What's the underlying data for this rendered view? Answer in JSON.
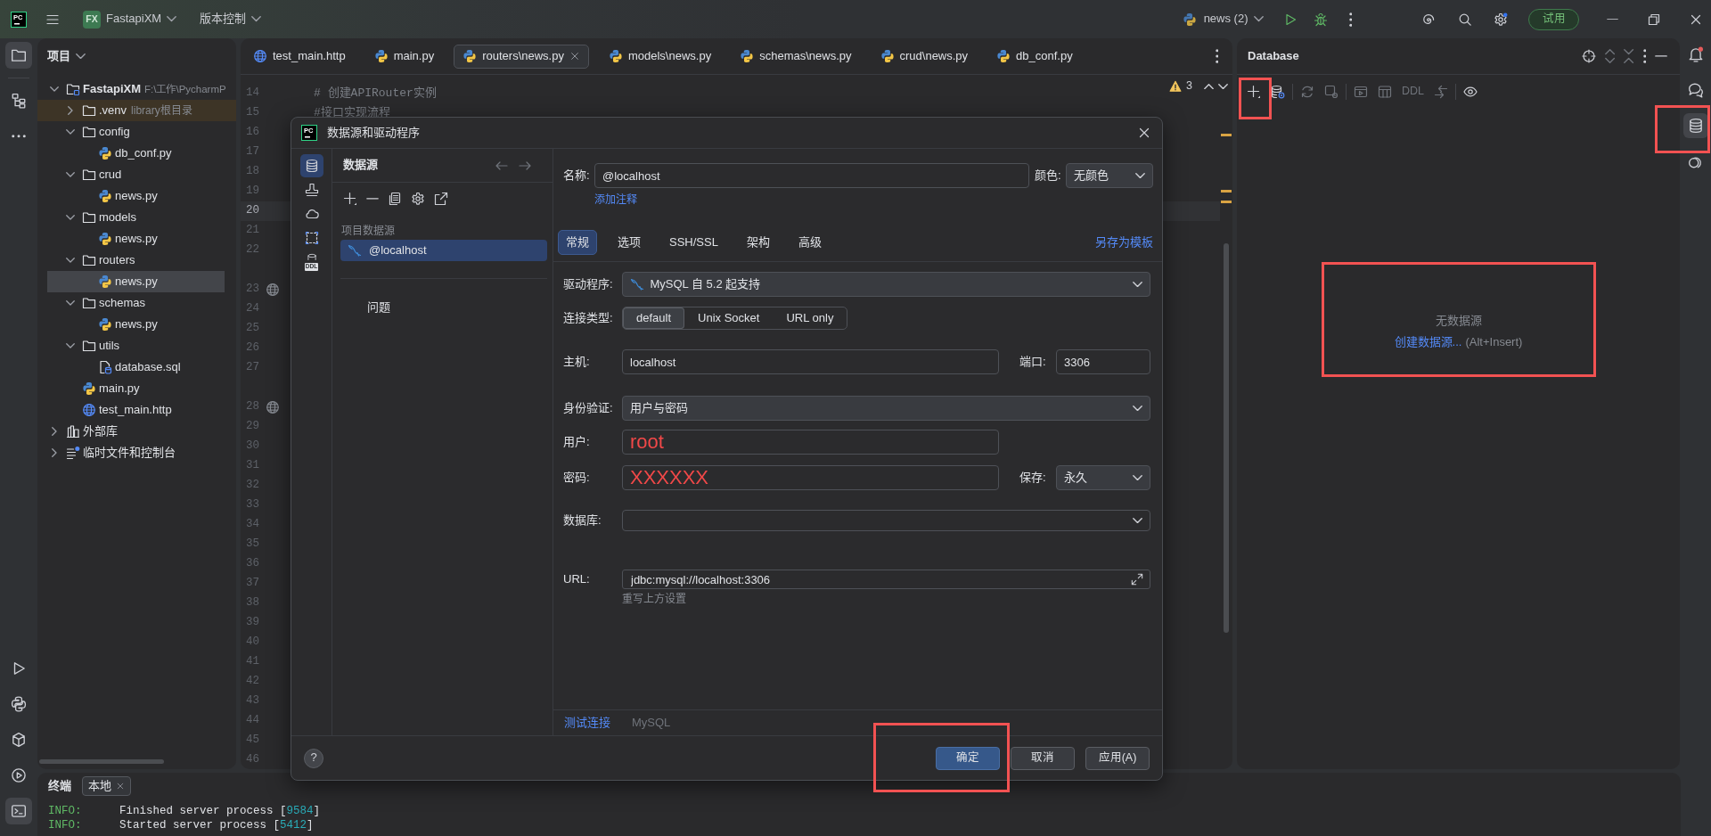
{
  "title_bar": {
    "logo": "PC",
    "project_badge": "FX",
    "project": "FastapiXM",
    "vcs": "版本控制",
    "run_config": "news (2)",
    "trial": "试用"
  },
  "left_strip": {
    "top": [
      {
        "selected": true
      },
      {
        "selected": false
      },
      {
        "selected": false
      }
    ],
    "bottom": [
      {
        "selected": false
      },
      {
        "selected": false
      },
      {
        "selected": false
      },
      {
        "selected": false
      },
      {
        "selected": true
      }
    ]
  },
  "project_panel": {
    "title": "项目",
    "tree": [
      {
        "kind": "project",
        "label": "FastapiXM",
        "note": "F:\\工作\\PycharmP",
        "expanded": true,
        "selected": false,
        "excluded": false,
        "children": [
          {
            "kind": "folder",
            "label": ".venv",
            "note": "library根目录",
            "expanded": false,
            "selected": false,
            "excluded": true
          },
          {
            "kind": "folder",
            "label": "config",
            "expanded": true,
            "selected": false,
            "excluded": false,
            "children": [
              {
                "kind": "python",
                "label": "db_conf.py",
                "selected": false,
                "excluded": false
              }
            ]
          },
          {
            "kind": "folder",
            "label": "crud",
            "expanded": true,
            "selected": false,
            "excluded": false,
            "children": [
              {
                "kind": "python",
                "label": "news.py",
                "selected": false,
                "excluded": false
              }
            ]
          },
          {
            "kind": "folder",
            "label": "models",
            "expanded": true,
            "selected": false,
            "excluded": false,
            "children": [
              {
                "kind": "python",
                "label": "news.py",
                "selected": false,
                "excluded": false
              }
            ]
          },
          {
            "kind": "folder",
            "label": "routers",
            "expanded": true,
            "selected": false,
            "excluded": false,
            "children": [
              {
                "kind": "python",
                "label": "news.py",
                "selected": true,
                "excluded": false
              }
            ]
          },
          {
            "kind": "folder",
            "label": "schemas",
            "expanded": true,
            "selected": false,
            "excluded": false,
            "children": [
              {
                "kind": "python",
                "label": "news.py",
                "selected": false,
                "excluded": false
              }
            ]
          },
          {
            "kind": "folder",
            "label": "utils",
            "expanded": true,
            "selected": false,
            "excluded": false,
            "children": [
              {
                "kind": "sql",
                "label": "database.sql",
                "selected": false,
                "excluded": false
              }
            ]
          },
          {
            "kind": "python",
            "label": "main.py",
            "selected": false,
            "excluded": false
          },
          {
            "kind": "http",
            "label": "test_main.http",
            "selected": false,
            "excluded": false
          }
        ]
      },
      {
        "kind": "library",
        "label": "外部库",
        "expanded": false,
        "selected": false,
        "excluded": false
      },
      {
        "kind": "scratches",
        "label": "临时文件和控制台",
        "expanded": false,
        "selected": false,
        "excluded": false
      }
    ]
  },
  "editor": {
    "tabs": [
      {
        "label": "test_main.http",
        "kind": "http",
        "selected": false
      },
      {
        "label": "main.py",
        "kind": "python",
        "selected": false
      },
      {
        "label": "routers\\news.py",
        "kind": "python",
        "selected": true
      },
      {
        "label": "models\\news.py",
        "kind": "python",
        "selected": false
      },
      {
        "label": "schemas\\news.py",
        "kind": "python",
        "selected": false
      },
      {
        "label": "crud\\news.py",
        "kind": "python",
        "selected": false
      },
      {
        "label": "db_conf.py",
        "kind": "python",
        "selected": false
      }
    ],
    "problems": "3",
    "stripe_marks": [
      {
        "kind": "warning"
      },
      {
        "kind": "warning"
      },
      {
        "kind": "warning"
      }
    ],
    "lines": [
      {
        "kind": "line",
        "number": "14",
        "code": "# 创建APIRouter实例",
        "current": false,
        "endpoint": false
      },
      {
        "kind": "line",
        "number": "15",
        "code": "#接口实现流程",
        "current": false,
        "endpoint": false
      },
      {
        "kind": "line",
        "number": "16",
        "current": false,
        "endpoint": false
      },
      {
        "kind": "line",
        "number": "17",
        "current": false,
        "endpoint": false
      },
      {
        "kind": "line",
        "number": "18",
        "current": false,
        "endpoint": false
      },
      {
        "kind": "line",
        "number": "19",
        "current": false,
        "endpoint": false
      },
      {
        "kind": "line",
        "number": "20",
        "current": true,
        "endpoint": false
      },
      {
        "kind": "line",
        "number": "21",
        "current": false,
        "endpoint": false
      },
      {
        "kind": "line",
        "number": "22",
        "current": false,
        "endpoint": false
      },
      {
        "kind": "gap"
      },
      {
        "kind": "line",
        "number": "23",
        "current": false,
        "endpoint": true
      },
      {
        "kind": "line",
        "number": "24",
        "current": false,
        "endpoint": false
      },
      {
        "kind": "line",
        "number": "25",
        "current": false,
        "endpoint": false
      },
      {
        "kind": "line",
        "number": "26",
        "current": false,
        "endpoint": false
      },
      {
        "kind": "line",
        "number": "27",
        "current": false,
        "endpoint": false
      },
      {
        "kind": "gap"
      },
      {
        "kind": "line",
        "number": "28",
        "current": false,
        "endpoint": true
      },
      {
        "kind": "line",
        "number": "29",
        "current": false,
        "endpoint": false
      },
      {
        "kind": "line",
        "number": "30",
        "current": false,
        "endpoint": false
      },
      {
        "kind": "line",
        "number": "31",
        "current": false,
        "endpoint": false
      },
      {
        "kind": "line",
        "number": "32",
        "current": false,
        "endpoint": false
      },
      {
        "kind": "line",
        "number": "33",
        "current": false,
        "endpoint": false
      },
      {
        "kind": "line",
        "number": "34",
        "current": false,
        "endpoint": false
      },
      {
        "kind": "line",
        "number": "35",
        "current": false,
        "endpoint": false
      },
      {
        "kind": "line",
        "number": "36",
        "current": false,
        "endpoint": false
      },
      {
        "kind": "line",
        "number": "37",
        "current": false,
        "endpoint": false
      },
      {
        "kind": "line",
        "number": "38",
        "current": false,
        "endpoint": false
      },
      {
        "kind": "line",
        "number": "39",
        "current": false,
        "endpoint": false
      },
      {
        "kind": "line",
        "number": "40",
        "current": false,
        "endpoint": false
      },
      {
        "kind": "line",
        "number": "41",
        "current": false,
        "endpoint": false
      },
      {
        "kind": "line",
        "number": "42",
        "current": false,
        "endpoint": false
      },
      {
        "kind": "line",
        "number": "43",
        "current": false,
        "endpoint": false
      },
      {
        "kind": "line",
        "number": "44",
        "current": false,
        "endpoint": false
      },
      {
        "kind": "line",
        "number": "45",
        "current": false,
        "endpoint": false
      },
      {
        "kind": "line",
        "number": "46",
        "current": false,
        "endpoint": false
      }
    ]
  },
  "dialog": {
    "logo": "PC",
    "title": "数据源和驱动程序",
    "nav": [
      {
        "selected": true
      },
      {
        "selected": false
      },
      {
        "selected": false
      },
      {
        "selected": false
      },
      {
        "selected": false,
        "label": "DDL"
      }
    ],
    "sources": {
      "title": "数据源",
      "group": "项目数据源",
      "items": [
        {
          "label": "@localhost",
          "selected": true
        }
      ],
      "problems": "问题"
    },
    "form": {
      "name": {
        "label": "名称:",
        "value": "@localhost"
      },
      "color": {
        "label": "颜色:",
        "value": "无颜色"
      },
      "add_comment": "添加注释",
      "tabs": [
        {
          "label": "常规",
          "selected": true
        },
        {
          "label": "选项",
          "selected": false
        },
        {
          "label": "SSH/SSL",
          "selected": false
        },
        {
          "label": "架构",
          "selected": false
        },
        {
          "label": "高级",
          "selected": false
        }
      ],
      "save_template": "另存为模板",
      "driver": {
        "label": "驱动程序:",
        "value": "MySQL 自 5.2 起支持"
      },
      "connection_type": {
        "label": "连接类型:",
        "options": [
          {
            "label": "default",
            "selected": true
          },
          {
            "label": "Unix Socket",
            "selected": false
          },
          {
            "label": "URL only",
            "selected": false
          }
        ]
      },
      "host": {
        "label": "主机:",
        "value": "localhost"
      },
      "port": {
        "label": "端口:",
        "value": "3306"
      },
      "auth": {
        "label": "身份验证:",
        "value": "用户与密码"
      },
      "user": {
        "label": "用户:",
        "value": "root"
      },
      "password": {
        "label": "密码:",
        "value": "XXXXXX"
      },
      "save": {
        "label": "保存:",
        "value": "永久"
      },
      "database": {
        "label": "数据库:"
      },
      "url": {
        "label": "URL:",
        "value": "jdbc:mysql://localhost:3306",
        "hint": "重写上方设置"
      },
      "bottom_links": [
        {
          "label": "测试连接",
          "disabled": false
        },
        {
          "label": "MySQL",
          "disabled": true
        }
      ]
    },
    "footer": {
      "help": "?",
      "buttons": [
        {
          "label": "确定",
          "kind": "primary",
          "highlighted": true
        },
        {
          "label": "取消",
          "kind": "secondary",
          "highlighted": false
        },
        {
          "label": "应用(A)",
          "kind": "secondary",
          "highlighted": false
        }
      ]
    }
  },
  "database_panel": {
    "title": "Database",
    "toolbar": [
      {
        "kind": "icon",
        "disabled": false,
        "highlighted": true
      },
      {
        "kind": "icon",
        "disabled": false,
        "highlighted": false
      },
      {
        "kind": "separator"
      },
      {
        "kind": "icon",
        "disabled": true,
        "highlighted": false
      },
      {
        "kind": "icon",
        "disabled": true,
        "highlighted": false
      },
      {
        "kind": "separator"
      },
      {
        "kind": "icon",
        "disabled": true,
        "highlighted": false
      },
      {
        "kind": "icon",
        "disabled": true,
        "highlighted": false
      },
      {
        "kind": "text",
        "label": "DDL",
        "disabled": true,
        "highlighted": false
      },
      {
        "kind": "icon",
        "disabled": true,
        "highlighted": false
      },
      {
        "kind": "separator"
      },
      {
        "kind": "icon",
        "disabled": false,
        "highlighted": false
      }
    ],
    "empty": {
      "message": "无数据源",
      "link": "创建数据源...",
      "shortcut": "(Alt+Insert)",
      "highlighted": true
    }
  },
  "right_strip": [
    {
      "selected": false,
      "highlighted": false
    },
    {
      "selected": false,
      "highlighted": false
    },
    {
      "selected": true,
      "highlighted": true
    },
    {
      "selected": false,
      "highlighted": false
    }
  ],
  "terminal": {
    "title": "终端",
    "tabs": [
      {
        "label": "本地",
        "selected": true
      }
    ],
    "lines": [
      {
        "level": "INFO:",
        "message": "Finished server process [",
        "pid": "9584",
        "end": "]"
      },
      {
        "level": "INFO:",
        "message": "Started server process [",
        "pid": "5412",
        "end": "]"
      }
    ]
  }
}
